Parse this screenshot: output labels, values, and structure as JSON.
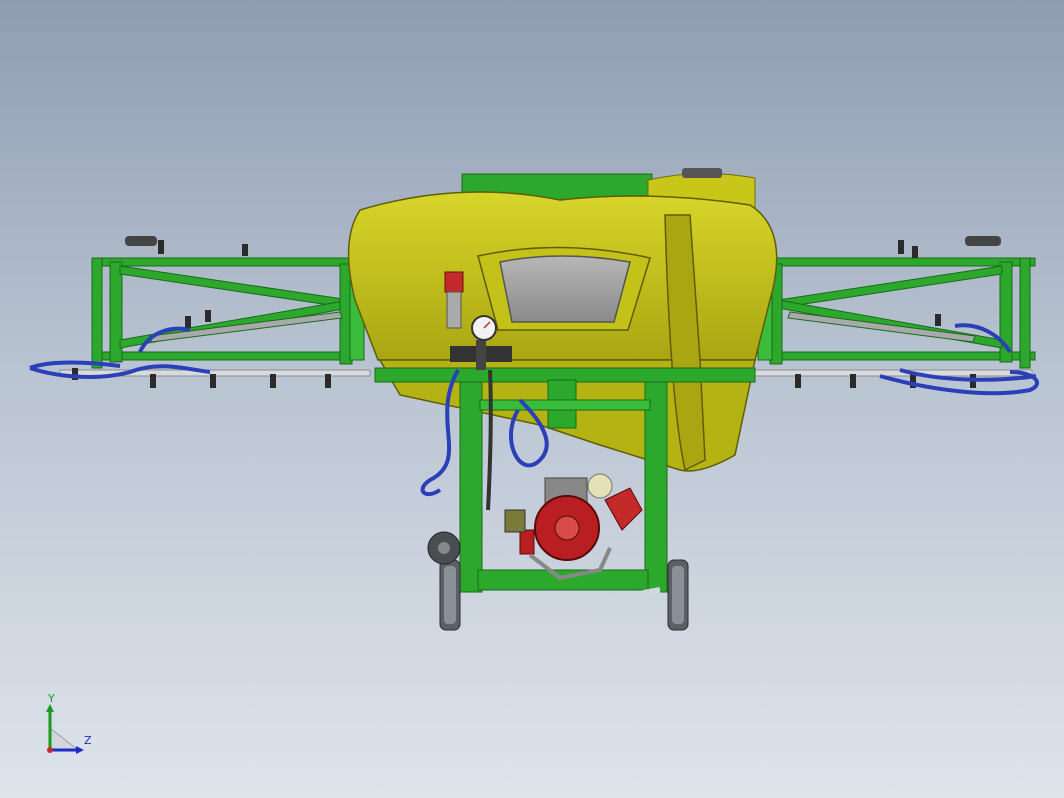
{
  "viewport": {
    "background_top": "#8f9db2",
    "background_bottom": "#dfe4eb"
  },
  "model": {
    "frame_color": "#2ca82c",
    "frame_dark": "#1a7a1a",
    "tank_color": "#c9c61a",
    "tank_dark": "#8f8d0e",
    "hose_color": "#2a3fb8",
    "pump_color": "#b81e22",
    "tire_color": "#555a60"
  },
  "triad": {
    "y_label": "Y",
    "z_label": "Z",
    "y_color": "#1a9a1a",
    "z_color": "#1a2ec8"
  }
}
